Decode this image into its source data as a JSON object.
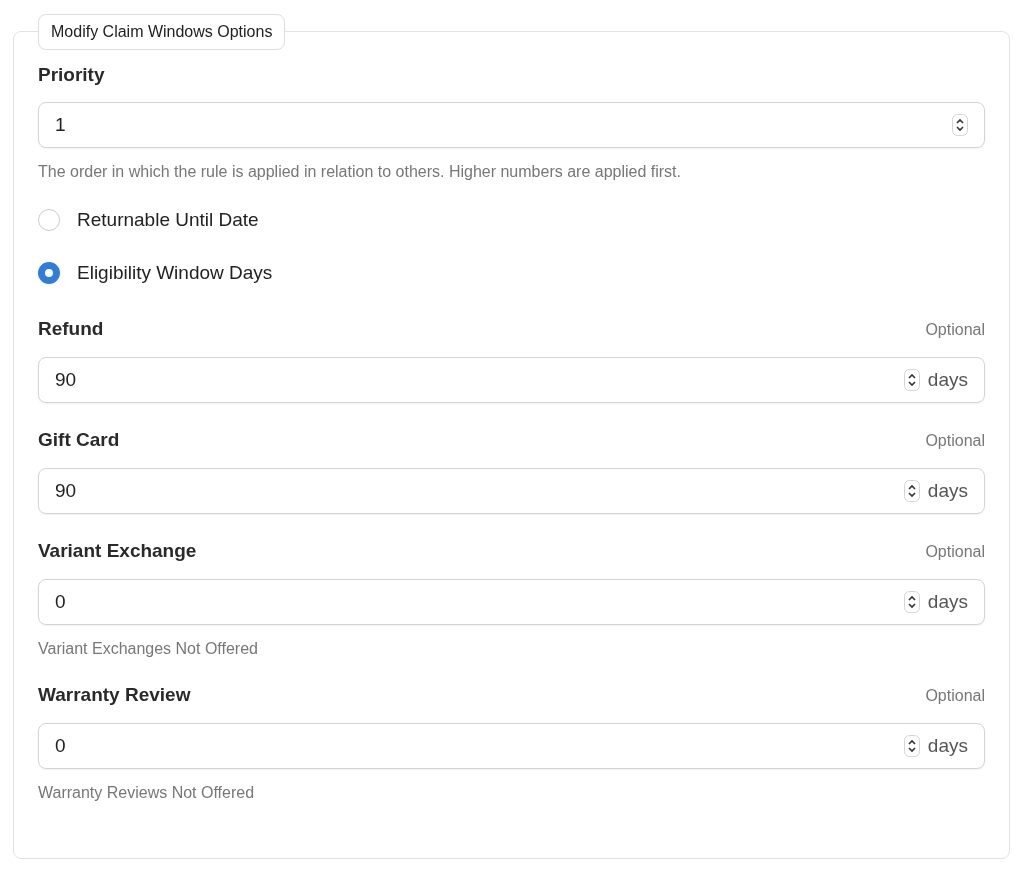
{
  "legend": "Modify Claim Windows Options",
  "priority": {
    "label": "Priority",
    "value": "1",
    "help": "The order in which the rule is applied in relation to others. Higher numbers are applied first."
  },
  "options": [
    {
      "label": "Returnable Until Date",
      "selected": false
    },
    {
      "label": "Eligibility Window Days",
      "selected": true
    }
  ],
  "fields": [
    {
      "label": "Refund",
      "optional": "Optional",
      "value": "90",
      "unit": "days"
    },
    {
      "label": "Gift Card",
      "optional": "Optional",
      "value": "90",
      "unit": "days"
    },
    {
      "label": "Variant Exchange",
      "optional": "Optional",
      "value": "0",
      "unit": "days",
      "help": "Variant Exchanges Not Offered"
    },
    {
      "label": "Warranty Review",
      "optional": "Optional",
      "value": "0",
      "unit": "days",
      "help": "Warranty Reviews Not Offered"
    }
  ]
}
